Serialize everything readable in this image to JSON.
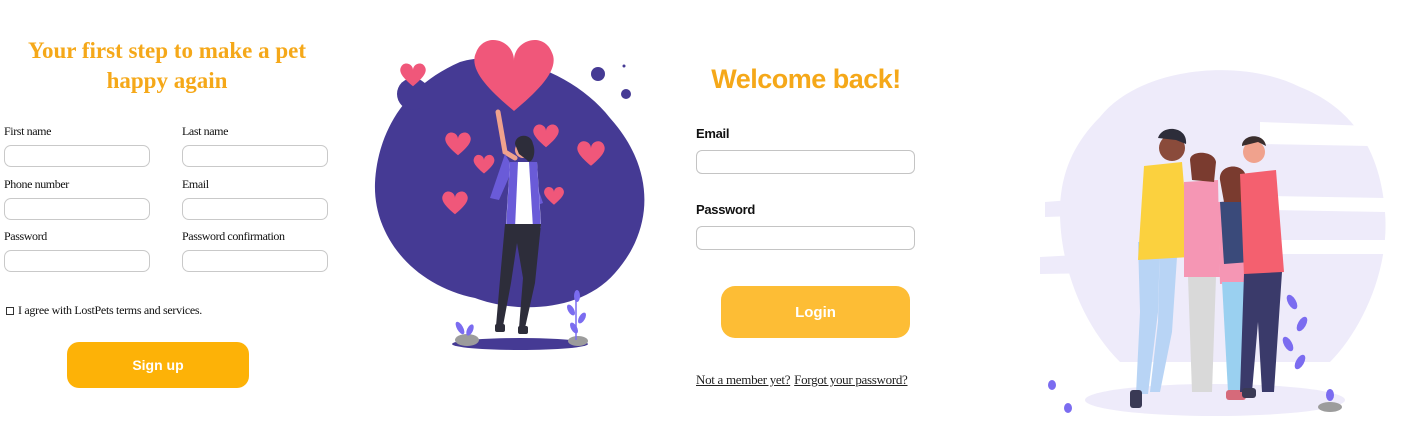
{
  "signup": {
    "title": "Your first step to make a pet happy again",
    "fields": [
      {
        "label": "First name"
      },
      {
        "label": "Last name"
      },
      {
        "label": "Phone number"
      },
      {
        "label": "Email"
      },
      {
        "label": "Password"
      },
      {
        "label": "Password confirmation"
      }
    ],
    "agree_label": "I agree with LostPets terms and services.",
    "submit_label": "Sign up"
  },
  "login": {
    "title": "Welcome back!",
    "email_label": "Email",
    "password_label": "Password",
    "submit_label": "Login",
    "not_member_link": "Not a member yet?",
    "forgot_link": "Forgot your password?"
  },
  "colors": {
    "accent": "#fdb207",
    "title": "#f5a819",
    "illustration_blob": "#453a94",
    "heart": "#f0577a",
    "lavender": "#eeebfa"
  }
}
